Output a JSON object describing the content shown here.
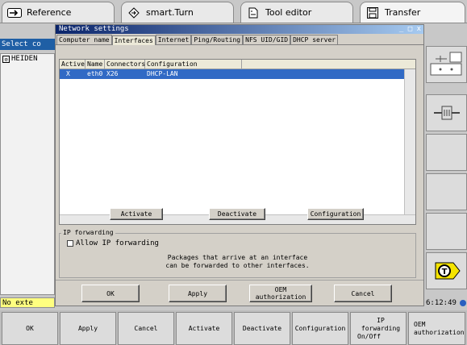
{
  "mode_tabs": [
    {
      "label": "Reference",
      "icon": "arrow-right-icon"
    },
    {
      "label": "smart.Turn",
      "icon": "diamond-arrow-icon"
    },
    {
      "label": "Tool editor",
      "icon": "file-icon"
    },
    {
      "label": "Transfer",
      "icon": "disk-icon"
    }
  ],
  "background": {
    "select_prefix": "Select co",
    "tree_item": "HEIDEN",
    "status_text": "No exte",
    "clock": "6:12:49"
  },
  "dialog": {
    "title": "Network settings",
    "title_controls": "_ □ x",
    "tabs": [
      "Computer name",
      "Interfaces",
      "Internet",
      "Ping/Routing",
      "NFS UID/GID",
      "DHCP server"
    ],
    "active_tab": "Interfaces",
    "table": {
      "columns": [
        "Active",
        "Name",
        "Connectors",
        "Configuration"
      ],
      "rows": [
        {
          "active": "X",
          "name": "eth0",
          "connectors": "X26",
          "configuration": "DHCP-LAN"
        }
      ]
    },
    "list_buttons": {
      "activate": "Activate",
      "deactivate": "Deactivate",
      "configuration": "Configuration"
    },
    "ip_forwarding": {
      "legend": "IP forwarding",
      "checkbox_label": "Allow IP forwarding",
      "checked": false,
      "info_line1": "Packages that arrive at an interface",
      "info_line2": "can be forwarded to other interfaces."
    },
    "bottom_buttons": {
      "ok": "OK",
      "apply": "Apply",
      "oem_line1": "OEM",
      "oem_line2": "authorization",
      "cancel": "Cancel"
    }
  },
  "softkeys": [
    {
      "line1": "OK",
      "line2": ""
    },
    {
      "line1": "Apply",
      "line2": ""
    },
    {
      "line1": "Cancel",
      "line2": ""
    },
    {
      "line1": "Activate",
      "line2": ""
    },
    {
      "line1": "Deactivate",
      "line2": ""
    },
    {
      "line1": "Configuration",
      "line2": ""
    },
    {
      "line1": "IP forwarding",
      "line2": "On/Off"
    },
    {
      "line1": "OEM",
      "line2": "authorization"
    }
  ]
}
